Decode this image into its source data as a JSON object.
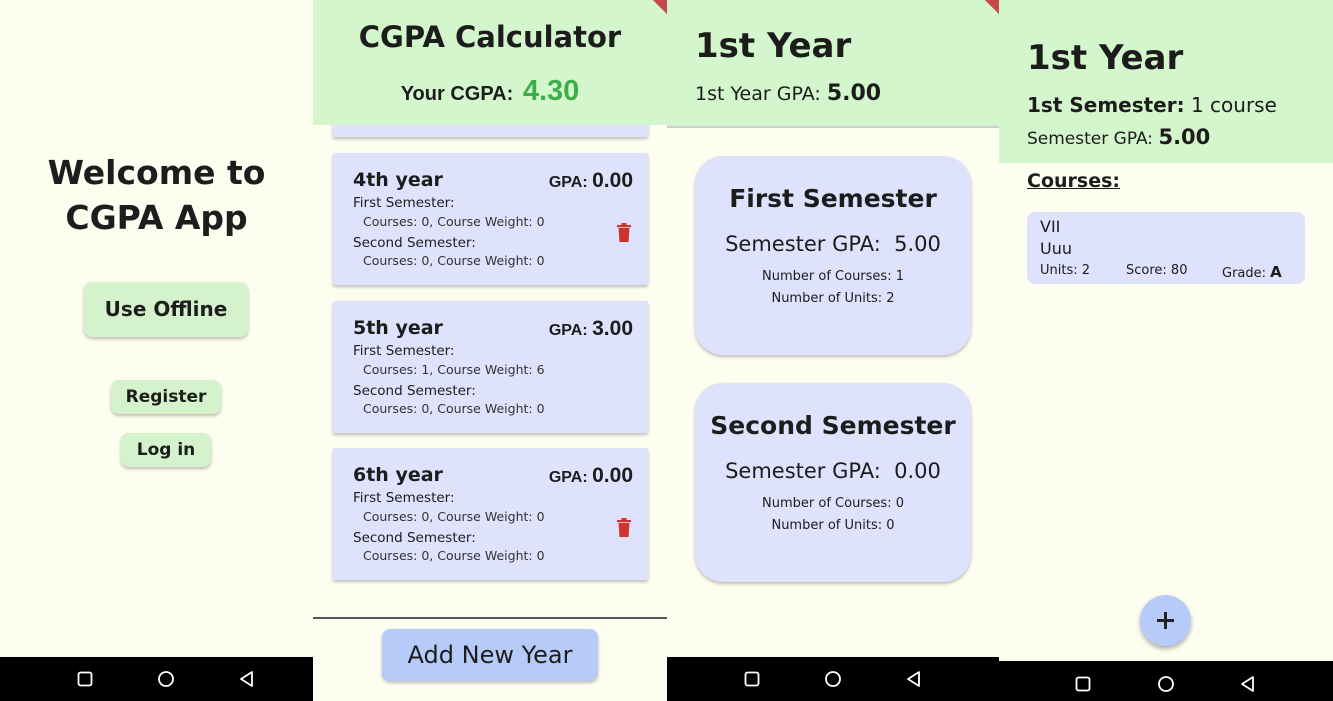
{
  "welcome_screen": {
    "title": "Welcome to CGPA App",
    "offline_label": "Use Offline",
    "register_label": "Register",
    "login_label": "Log in"
  },
  "calculator_screen": {
    "title": "CGPA Calculator",
    "cgpa_label": "Your CGPA:",
    "cgpa_value": "4.30",
    "years": [
      {
        "name": "4th year",
        "gpa_label": "GPA:",
        "gpa": "0.00",
        "first_sem_label": "First Semester:",
        "first_sem_detail": "Courses: 0,  Course Weight: 0",
        "second_sem_label": "Second Semester:",
        "second_sem_detail": "Courses: 0,  Course Weight: 0",
        "deletable": true
      },
      {
        "name": "5th year",
        "gpa_label": "GPA:",
        "gpa": "3.00",
        "first_sem_label": "First Semester:",
        "first_sem_detail": "Courses: 1,  Course Weight: 6",
        "second_sem_label": "Second Semester:",
        "second_sem_detail": "Courses: 0,  Course Weight: 0",
        "deletable": false
      },
      {
        "name": "6th year",
        "gpa_label": "GPA:",
        "gpa": "0.00",
        "first_sem_label": "First Semester:",
        "first_sem_detail": "Courses: 0,  Course Weight: 0",
        "second_sem_label": "Second Semester:",
        "second_sem_detail": "Courses: 0,  Course Weight: 0",
        "deletable": true
      }
    ],
    "add_year_label": "Add New Year"
  },
  "year_screen": {
    "title": "1st Year",
    "gpa_label": "1st Year GPA:",
    "gpa_value": "5.00",
    "semesters": [
      {
        "title": "First Semester",
        "gpa_label": "Semester GPA:",
        "gpa": "5.00",
        "courses_text": "Number of Courses:  1",
        "units_text": "Number of Units:  2"
      },
      {
        "title": "Second Semester",
        "gpa_label": "Semester GPA:",
        "gpa": "0.00",
        "courses_text": "Number of Courses:  0",
        "units_text": "Number of Units:  0"
      }
    ]
  },
  "semester_screen": {
    "title": "1st Year",
    "semester_label": "1st Semester:",
    "course_count": "1 course",
    "gpa_label": "Semester GPA:",
    "gpa_value": "5.00",
    "courses_heading": "Courses:",
    "course": {
      "code": "VII",
      "name": "Uuu",
      "units": "Units: 2",
      "score": "Score: 80",
      "grade_label": "Grade:",
      "grade": "A"
    }
  },
  "icons": {
    "delete": "trash-icon",
    "add": "plus-icon",
    "nav": [
      "square-icon",
      "circle-icon",
      "triangle-back-icon"
    ]
  },
  "colors": {
    "header_green": "#d4f6cc",
    "card_lavender": "#dfe2fd",
    "button_blue": "#b6cbf8",
    "cgpa_green": "#3cae49",
    "delete_red": "#d0332e",
    "background": "#fdfdf0"
  }
}
